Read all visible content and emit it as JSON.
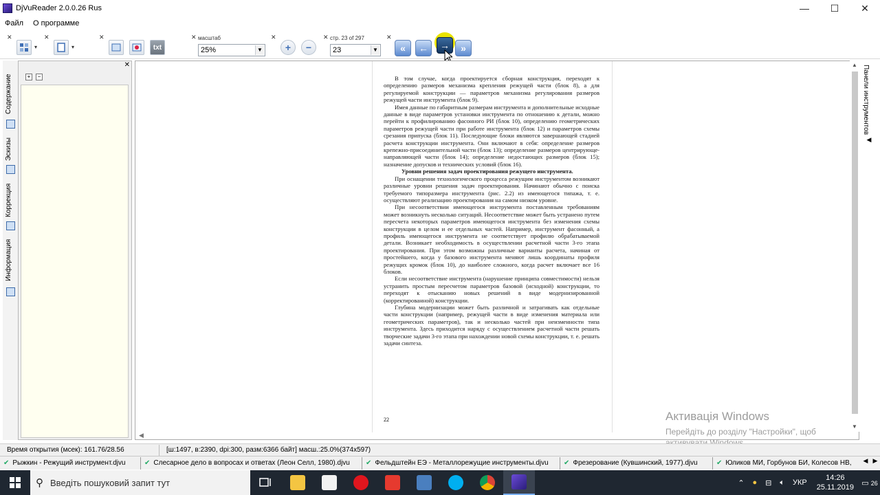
{
  "window": {
    "title": "DjVuReader 2.0.0.26 Rus",
    "minimize": "—",
    "maximize": "☐",
    "close": "✕"
  },
  "menu": {
    "items": [
      "Файл",
      "О программе"
    ]
  },
  "toolbar": {
    "zoom_caption": "масштаб",
    "zoom_value": "25%",
    "page_caption": "стр. 23 of 297",
    "page_value": "23",
    "txt_label": "txt"
  },
  "document": {
    "paragraphs": [
      "В том случае, когда проектируется сборная конструкция, переходят к определению размеров механизма крепления режущей части (блок 8), а для регулируемой конструкции — параметров механизма регулирования размеров режущей части инструмента (блок 9).",
      "Имея данные по габаритным размерам инструмента и дополнительные исходные данные в виде параметров установки инструмента по отношению к детали, можно перейти к профилированию фасонного РИ (блок 10), определению геометрических параметров режущей части при работе инструмента (блок 12) и параметров схемы срезания припуска (блок 11). Последующие блоки являются завершающей стадией расчета конструкции инструмента. Они включают в себя: определение размеров крепежно-присоединительной части (блок 13); определение размеров центрирующе-направляющей части (блок 14); определение недостающих размеров (блок 15); назначение допусков и технических условий (блок 16).",
      "Уровни решения задач проектирования режущего инструмента.",
      "При оснащении технологического процесса режущим инструментом возникают различные уровни решения задач проектирования. Начинают обычно с поиска требуемого типоразмера инструмента (рис. 2.2) из имеющегося типажа, т. е. осуществляют реализацию проектирования на самом низком уровне.",
      "При несоответствии имеющегося инструмента поставленным требованиям может возникнуть несколько ситуаций. Несоответствие может быть устранено путем пересчета некоторых параметров имеющегося инструмента без изменения схемы конструкции в целом и ее отдельных частей. Например, инструмент фасонный, а профиль имеющегося инструмента не соответствует профилю обрабатываемой детали. Возникает необходимость в осуществлении расчетной части 3-го этапа проектирования. При этом возможны различные варианты расчета, начиная от простейшего, когда у базового инструмента меняют лишь координаты профиля режущих кромок (блок 10), до наиболее сложного, когда расчет включает все 16 блоков.",
      "Если несоответствие инструмента (нарушение принципа совместимости) нельзя устранить простым пересчетом параметров базовой (исходной) конструкции, то переходят к отысканию новых решений в виде модернизированной (корректированной) конструкции.",
      "Глубина модернизации может быть различной и затрагивать как отдельные части конструкции (например, режущей части в виде изменения материала или геометрических параметров), так и несколько частей при неизменности типа инструмента. Здесь приходится наряду с осуществлением расчетной части решать творческие задачи 3-го этапа при нахождении новой схемы конструкции, т. е. решать задачи синтеза."
    ],
    "page_number": "22"
  },
  "left_panel": {
    "tabs": [
      "Содержание",
      "Эскизы",
      "Коррекция",
      "Информация"
    ]
  },
  "right_panel": {
    "label": "Панели инструментов"
  },
  "watermark": {
    "line1": "Активація Windows",
    "line2": "Перейдіть до розділу \"Настройки\", щоб",
    "line3": "активувати Windows."
  },
  "status": {
    "open_time": "Время открытия (мсек): 161.76/28.56",
    "info": "[ш:1497, в:2390, dpi:300, разм:6366 байт] масш.:25.0%(374x597)"
  },
  "doc_tabs": [
    "Рыжкин - Режущий инструмент.djvu",
    "Слесарное дело в вопросах и ответах (Леон Селл, 1980).djvu",
    "Фельдштейн ЕЭ - Металлорежущие инструменты.djvu",
    "Фрезерование (Кувшинский, 1977).djvu",
    "Юликов МИ, Горбунов БИ, Колесов НВ,"
  ],
  "taskbar": {
    "search_placeholder": "Введіть пошуковий запит тут",
    "lang": "УКР",
    "time": "14:26",
    "date": "25.11.2019",
    "notif_count": "26"
  },
  "colors": {
    "highlight": "#e9e300",
    "taskbar": "#1f2731",
    "nav_button": "#5d8ad0"
  }
}
